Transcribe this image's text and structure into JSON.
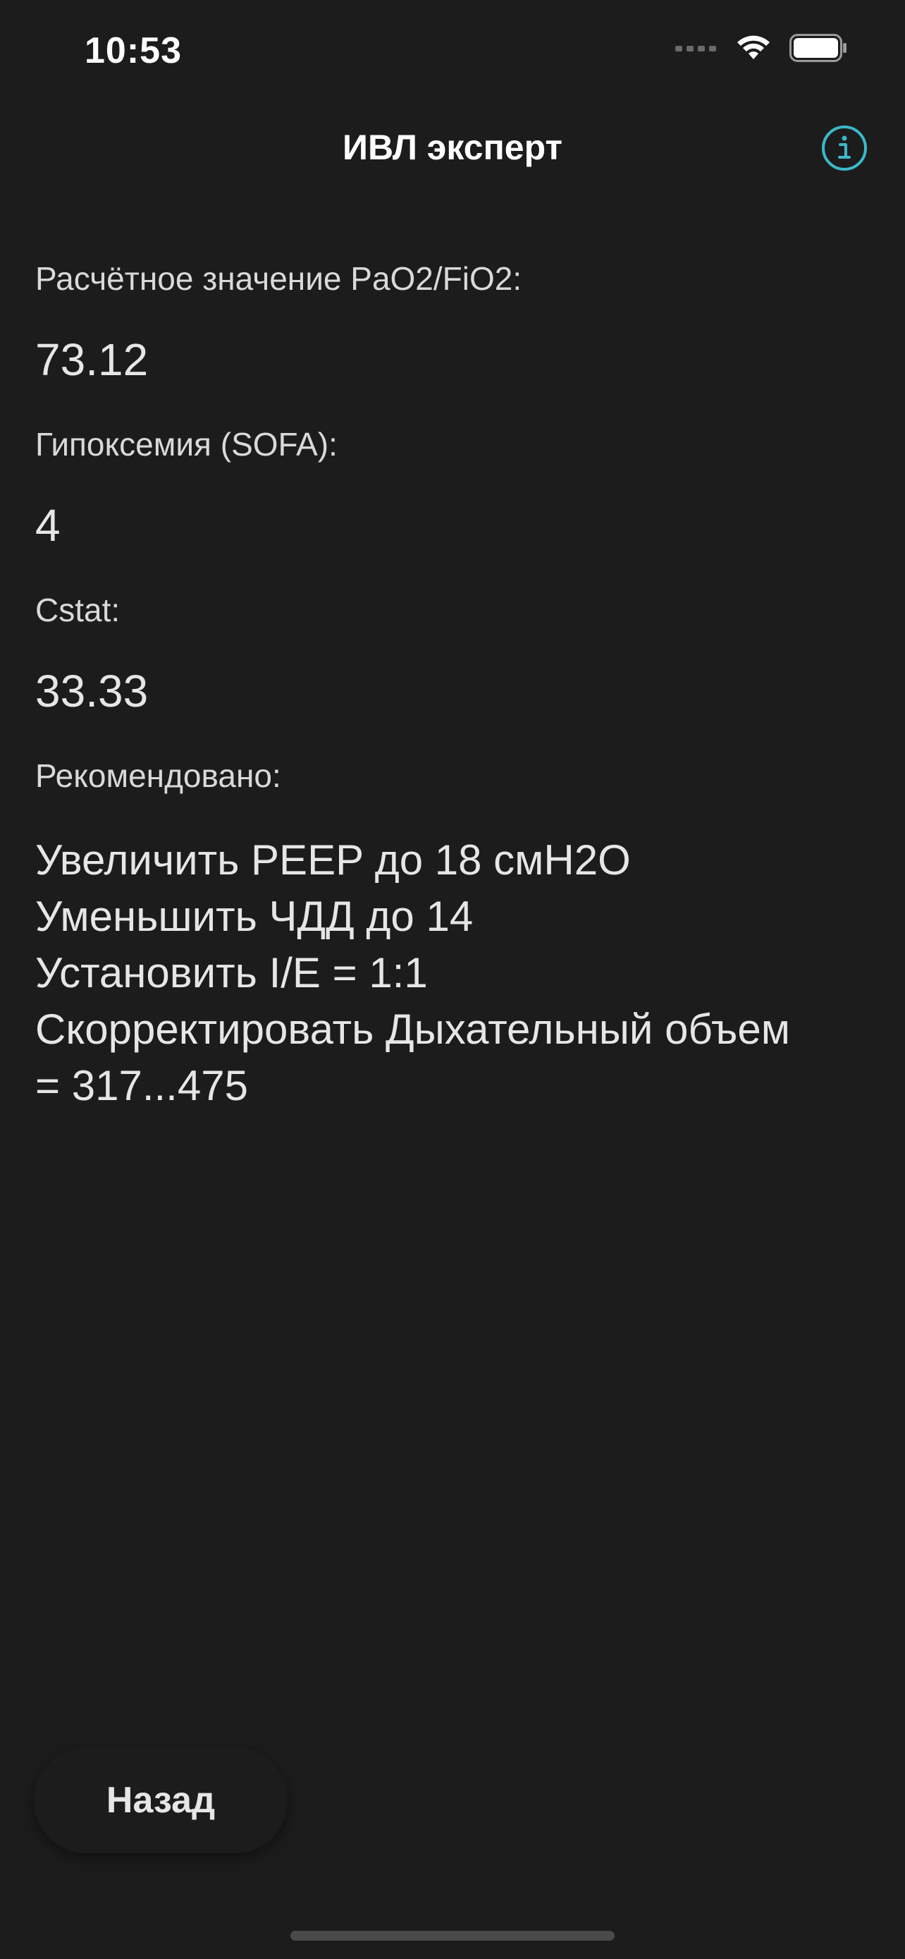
{
  "status_bar": {
    "time": "10:53"
  },
  "nav": {
    "title": "ИВЛ эксперт",
    "info_icon": "info-circle-icon",
    "accent_color": "#3bb8c9"
  },
  "results": {
    "pf_label": "Расчётное значение PaO2/FiO2:",
    "pf_value": "73.12",
    "sofa_label": "Гипоксемия (SOFA):",
    "sofa_value": "4",
    "cstat_label": "Cstat:",
    "cstat_value": "33.33",
    "recommend_label": "Рекомендовано:",
    "recommendations": [
      "Увеличить PEEP до 18 смН2О",
      "Уменьшить ЧДД до 14",
      "Установить I/E = 1:1",
      "Скорректировать Дыхательный объем",
      "= 317...475"
    ]
  },
  "footer": {
    "back_label": "Назад"
  }
}
